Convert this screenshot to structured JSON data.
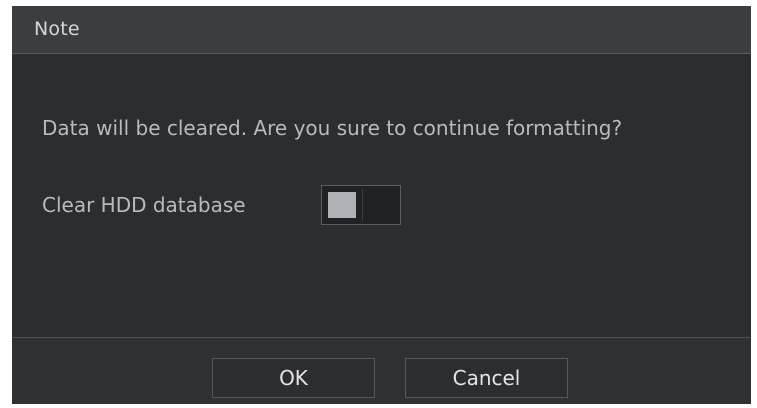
{
  "dialog": {
    "title": "Note",
    "message": "Data will be cleared. Are you sure to continue formatting?",
    "toggle": {
      "label": "Clear HDD database",
      "state": "off"
    },
    "buttons": {
      "ok_label": "OK",
      "cancel_label": "Cancel"
    }
  },
  "colors": {
    "dialog_bg": "#2b2d2f",
    "titlebar_bg": "#3b3e41",
    "text": "#b9babb",
    "toggle_knob": "#aeb2b6"
  }
}
